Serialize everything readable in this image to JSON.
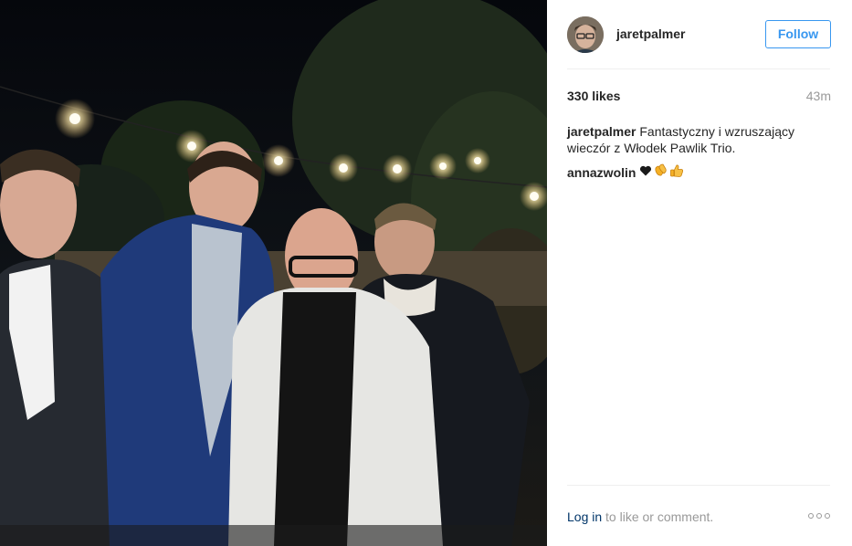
{
  "post": {
    "image_alt": "Four men posing outdoors at night under string lights",
    "author": "jaretpalmer",
    "follow_label": "Follow",
    "likes": "330 likes",
    "time": "43m",
    "caption_text": "Fantastyczny i wzruszający wieczór z Włodek Pawlik Trio.",
    "comments": [
      {
        "user": "annazwolin",
        "emojis": [
          "heart-icon",
          "clapping-hands-icon",
          "thumbs-up-icon"
        ]
      }
    ],
    "login_link": "Log in",
    "login_suffix": " to like or comment."
  },
  "colors": {
    "accent": "#3897f0",
    "link": "#003569",
    "muted": "#999999",
    "divider": "#efefef"
  }
}
